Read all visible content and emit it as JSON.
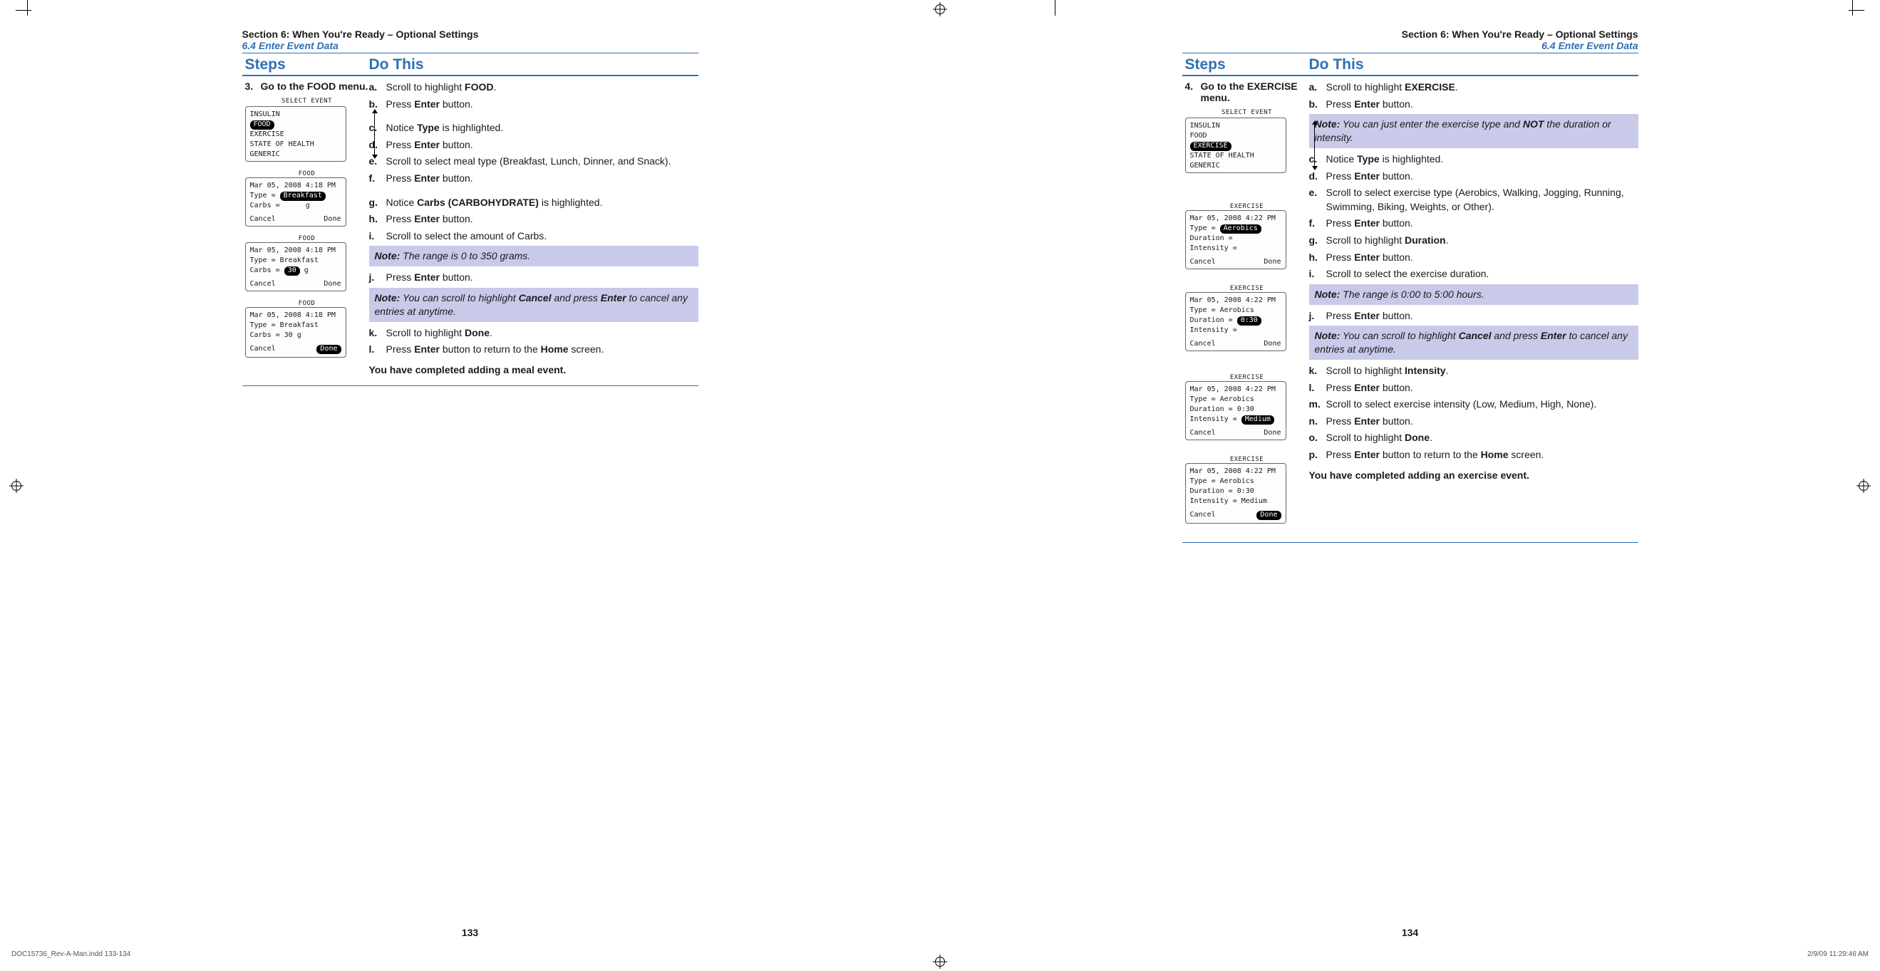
{
  "header": {
    "section": "Section 6: When You're Ready – Optional Settings",
    "sub": "6.4 Enter Event Data"
  },
  "colheads": {
    "steps": "Steps",
    "do": "Do This"
  },
  "left": {
    "stepnum": "3.",
    "steptitle": "Go to the FOOD menu.",
    "screens": {
      "select_event": {
        "title": "SELECT EVENT",
        "items": [
          "INSULIN",
          "FOOD",
          "EXERCISE",
          "STATE OF HEALTH",
          "GENERIC"
        ],
        "selected": "FOOD"
      },
      "food1": {
        "title": "FOOD",
        "dt": "Mar 05, 2008   4:18 PM",
        "type_lbl": "Type =",
        "type_val": "Breakfast",
        "type_sel": true,
        "carbs_lbl": "Carbs =",
        "carbs_val": "",
        "unit": "g",
        "cancel": "Cancel",
        "done": "Done"
      },
      "food2": {
        "title": "FOOD",
        "dt": "Mar 05, 2008   4:18 PM",
        "type_lbl": "Type = Breakfast",
        "carbs_lbl": "Carbs =",
        "carbs_val": "30",
        "carbs_sel": true,
        "unit": "g",
        "cancel": "Cancel",
        "done": "Done"
      },
      "food3": {
        "title": "FOOD",
        "dt": "Mar 05, 2008   4:18 PM",
        "type_lbl": "Type = Breakfast",
        "carbs_lbl": "Carbs =  30  g",
        "cancel": "Cancel",
        "done": "Done",
        "done_sel": true
      }
    },
    "instr": {
      "a": [
        "Scroll to highlight ",
        "FOOD",
        "."
      ],
      "b": [
        "Press ",
        "Enter",
        " button."
      ],
      "c": [
        "Notice ",
        "Type",
        " is highlighted."
      ],
      "d": [
        "Press ",
        "Enter",
        " button."
      ],
      "e": [
        "Scroll to select meal type (Breakfast, Lunch, Dinner, and Snack)."
      ],
      "f": [
        "Press ",
        "Enter",
        " button."
      ],
      "g": [
        "Notice ",
        "Carbs (CARBOHYDRATE)",
        " is highlighted."
      ],
      "h": [
        "Press ",
        "Enter",
        " button."
      ],
      "i": [
        "Scroll to select the amount of Carbs."
      ],
      "note1": "The range is 0 to 350 grams.",
      "j": [
        "Press ",
        "Enter",
        " button."
      ],
      "note2_pre": "You can scroll to highlight ",
      "note2_b1": "Cancel",
      "note2_mid": " and press ",
      "note2_b2": "Enter",
      "note2_post": " to cancel any entries at anytime.",
      "k": [
        "Scroll to highlight ",
        "Done",
        "."
      ],
      "l": [
        "Press ",
        "Enter",
        " button to return to the ",
        "Home",
        " screen."
      ],
      "complete": "You have completed adding a meal event"
    },
    "pagenum": "133"
  },
  "right": {
    "stepnum": "4.",
    "steptitle": "Go to the EXERCISE menu.",
    "screens": {
      "select_event": {
        "title": "SELECT EVENT",
        "items": [
          "INSULIN",
          "FOOD",
          "EXERCISE",
          "STATE OF HEALTH",
          "GENERIC"
        ],
        "selected": "EXERCISE"
      },
      "ex1": {
        "title": "EXERCISE",
        "dt": "Mar 05, 2008   4:22 PM",
        "l1": "Type =",
        "l1v": "Aerobics",
        "l1sel": true,
        "l2": "Duration =",
        "l3": "Intensity =",
        "cancel": "Cancel",
        "done": "Done"
      },
      "ex2": {
        "title": "EXERCISE",
        "dt": "Mar 05, 2008   4:22 PM",
        "l1": "Type = Aerobics",
        "l2": "Duration =",
        "l2v": "0:30",
        "l2sel": true,
        "l3": "Intensity =",
        "cancel": "Cancel",
        "done": "Done"
      },
      "ex3": {
        "title": "EXERCISE",
        "dt": "Mar 05, 2008   4:22 PM",
        "l1": "Type = Aerobics",
        "l2": "Duration = 0:30",
        "l3": "Intensity =",
        "l3v": "Medium",
        "l3sel": true,
        "cancel": "Cancel",
        "done": "Done"
      },
      "ex4": {
        "title": "EXERCISE",
        "dt": "Mar 05, 2008   4:22 PM",
        "l1": "Type = Aerobics",
        "l2": "Duration = 0:30",
        "l3": "Intensity = Medium",
        "cancel": "Cancel",
        "done": "Done",
        "done_sel": true
      }
    },
    "instr": {
      "a": [
        "Scroll to highlight ",
        "EXERCISE",
        "."
      ],
      "b": [
        "Press ",
        "Enter",
        " button."
      ],
      "note0_pre": "You can just enter the exercise type and ",
      "note0_b": "NOT",
      "note0_post": " the duration or intensity.",
      "c": [
        "Notice ",
        "Type",
        " is highlighted."
      ],
      "d": [
        "Press ",
        "Enter",
        " button."
      ],
      "e": [
        "Scroll to select exercise type (Aerobics, Walking, Jogging, Running, Swimming, Biking, Weights, or Other)."
      ],
      "f": [
        "Press ",
        "Enter",
        " button."
      ],
      "g": [
        "Scroll to highlight ",
        "Duration",
        "."
      ],
      "h": [
        "Press ",
        "Enter",
        " button."
      ],
      "i": [
        "Scroll to select the exercise duration."
      ],
      "note1": "The range is 0:00 to 5:00 hours.",
      "j": [
        "Press ",
        "Enter",
        " button."
      ],
      "note2_pre": "You can scroll to highlight ",
      "note2_b1": "Cancel",
      "note2_mid": " and press ",
      "note2_b2": "Enter",
      "note2_post": " to cancel any entries at anytime.",
      "k": [
        "Scroll to highlight ",
        "Intensity",
        "."
      ],
      "l": [
        "Press ",
        "Enter",
        " button."
      ],
      "m": [
        "Scroll to select exercise intensity (Low, Medium, High, None)."
      ],
      "n": [
        "Press ",
        "Enter",
        " button."
      ],
      "o": [
        "Scroll to highlight ",
        "Done",
        "."
      ],
      "p": [
        "Press ",
        "Enter",
        " button to return to the ",
        "Home",
        " screen."
      ],
      "complete": "You have completed adding an exercise event"
    },
    "pagenum": "134"
  },
  "footer": {
    "left": "DOC15736_Rev-A-Man.indd   133-134",
    "right": "2/9/09   11:29:46 AM"
  },
  "notelead": "Note:"
}
